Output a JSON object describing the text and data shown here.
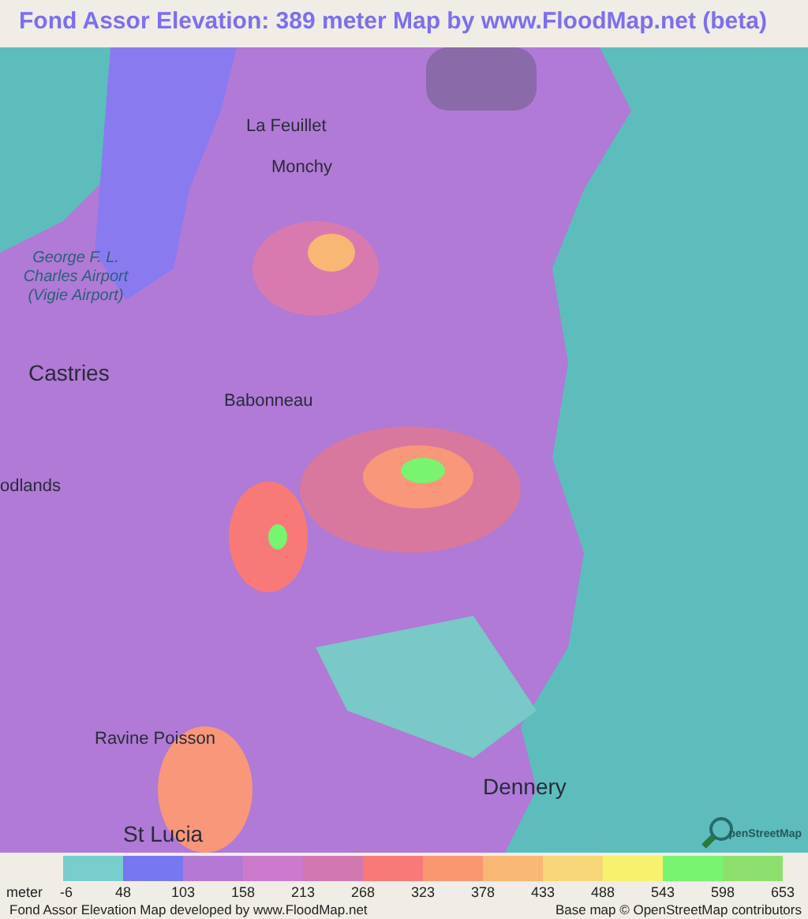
{
  "title": "Fond Assor Elevation: 389 meter Map by www.FloodMap.net (beta)",
  "map": {
    "labels": [
      {
        "text": "La Feuillet"
      },
      {
        "text": "Monchy"
      },
      {
        "text": "George F. L. Charles Airport (Vigie Airport)",
        "kind": "italic"
      },
      {
        "text": "Castries",
        "kind": "large"
      },
      {
        "text": "Babonneau"
      },
      {
        "text": "odlands"
      },
      {
        "text": "Ravine Poisson"
      },
      {
        "text": "Dennery",
        "kind": "large"
      },
      {
        "text": "St Lucia",
        "kind": "large"
      }
    ],
    "attribution_logo": "penStreetMap"
  },
  "legend": {
    "unit": "meter",
    "swatches": [
      {
        "color": "#78cdcd"
      },
      {
        "color": "#7777f2"
      },
      {
        "color": "#b479d4"
      },
      {
        "color": "#cc7acc"
      },
      {
        "color": "#d278b0"
      },
      {
        "color": "#f77a78"
      },
      {
        "color": "#f8976f"
      },
      {
        "color": "#f8b774"
      },
      {
        "color": "#f8d778"
      },
      {
        "color": "#f6f26e"
      },
      {
        "color": "#78f471"
      },
      {
        "color": "#8ee06e"
      }
    ],
    "ticks": [
      "-6",
      "48",
      "103",
      "158",
      "213",
      "268",
      "323",
      "378",
      "433",
      "488",
      "543",
      "598",
      "653"
    ]
  },
  "footer": {
    "left": "Fond Assor Elevation Map developed by www.FloodMap.net",
    "right": "Base map © OpenStreetMap contributors"
  }
}
